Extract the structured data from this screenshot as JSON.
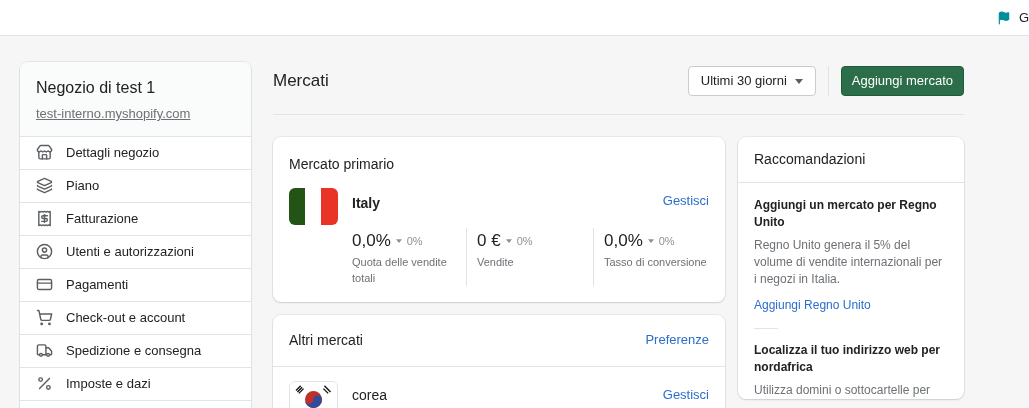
{
  "topbar": {
    "user_initial": "G"
  },
  "sidebar": {
    "store_name": "Negozio di test 1",
    "store_url": "test-interno.myshopify.com",
    "items": [
      {
        "label": "Dettagli negozio"
      },
      {
        "label": "Piano"
      },
      {
        "label": "Fatturazione"
      },
      {
        "label": "Utenti e autorizzazioni"
      },
      {
        "label": "Pagamenti"
      },
      {
        "label": "Check-out e account"
      },
      {
        "label": "Spedizione e consegna"
      },
      {
        "label": "Imposte e dazi"
      }
    ]
  },
  "page": {
    "title": "Mercati",
    "date_range": "Ultimi 30 giorni",
    "primary_action": "Aggiungi mercato"
  },
  "primary_market": {
    "heading": "Mercato primario",
    "country": "Italy",
    "action": "Gestisci",
    "metrics": [
      {
        "value": "0,0%",
        "change": "0%",
        "label": "Quota delle vendite totali"
      },
      {
        "value": "0 €",
        "change": "0%",
        "label": "Vendite"
      },
      {
        "value": "0,0%",
        "change": "0%",
        "label": "Tasso di conversione"
      }
    ]
  },
  "other_markets": {
    "heading": "Altri mercati",
    "action": "Preferenze",
    "markets": [
      {
        "country": "corea",
        "action": "Gestisci"
      }
    ]
  },
  "recommendations": {
    "heading": "Raccomandazioni",
    "items": [
      {
        "title": "Aggiungi un mercato per Regno Unito",
        "body": "Regno Unito genera il 5% del volume di vendite internazionali per i negozi in Italia.",
        "link": "Aggiungi Regno Unito"
      },
      {
        "title": "Localizza il tuo indirizzo web per nordafrica",
        "body": "Utilizza domini o sottocartelle per"
      }
    ]
  }
}
